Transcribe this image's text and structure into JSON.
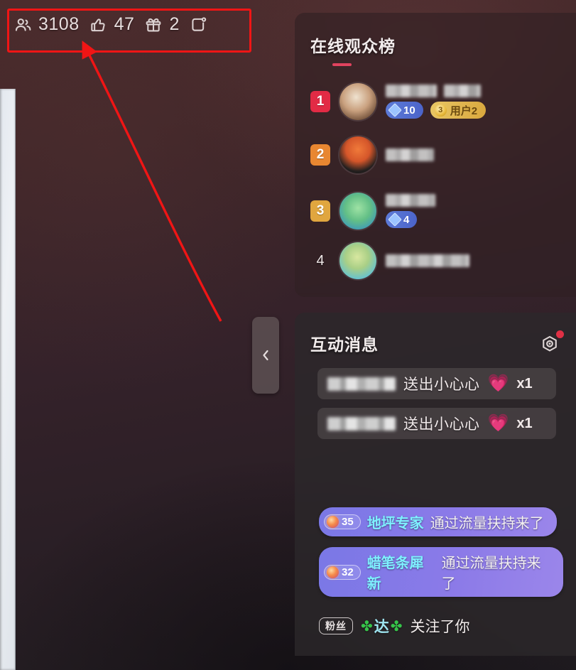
{
  "stats": [
    {
      "icon": "viewers-icon",
      "value": "3108"
    },
    {
      "icon": "thumbs-up-icon",
      "value": "47"
    },
    {
      "icon": "gift-icon",
      "value": "2"
    },
    {
      "icon": "share-icon",
      "value": ""
    }
  ],
  "annotation": {
    "shape": "red-rectangle",
    "color": "#f01515",
    "arrow": "red-arrow-pointing-to-viewer-count"
  },
  "viewers_panel": {
    "title": "在线观众榜",
    "accent_color": "#e0435e",
    "rows": [
      {
        "rank": "1",
        "rank_color": "#e22b45",
        "name": "",
        "badges": [
          {
            "type": "level",
            "icon": "diamond-icon",
            "value": "10",
            "color": "#4b63c9"
          },
          {
            "type": "fanclub",
            "icon": "fan-level-icon",
            "level": "3",
            "value": "用户2",
            "color": "#d9a73d"
          }
        ]
      },
      {
        "rank": "2",
        "rank_color": "#e88731",
        "name": "",
        "badges": []
      },
      {
        "rank": "3",
        "rank_color": "#e0a63f",
        "name": "",
        "badges": [
          {
            "type": "level",
            "icon": "diamond-icon",
            "value": "4",
            "color": "#4b63c9"
          }
        ]
      },
      {
        "rank": "4",
        "rank_color": "",
        "name": "",
        "badges": []
      }
    ]
  },
  "messages_panel": {
    "title": "互动消息",
    "settings_icon": "gear-icon",
    "has_notification_dot": true,
    "notification_color": "#e03045",
    "gifts": [
      {
        "user": "",
        "action": "送出小心心",
        "gift_icon": "heart-gift-icon",
        "count": "x1"
      },
      {
        "user": "",
        "action": "送出小心心",
        "gift_icon": "heart-gift-icon",
        "count": "x1"
      }
    ],
    "enters": [
      {
        "level": "35",
        "user": "地坪专家",
        "action": "通过流量扶持来了",
        "chip_color": "#8b7ae8"
      },
      {
        "level": "32",
        "user": "蜡笔条犀新",
        "action": "通过流量扶持来了",
        "chip_color": "#8b7ae8"
      }
    ],
    "follow": {
      "tag": "粉丝",
      "user_prefix": "✤",
      "user": "达",
      "user_suffix": "✤",
      "action": "关注了你"
    }
  },
  "collapse_button": {
    "icon": "chevron-left-icon",
    "label": "‹"
  }
}
